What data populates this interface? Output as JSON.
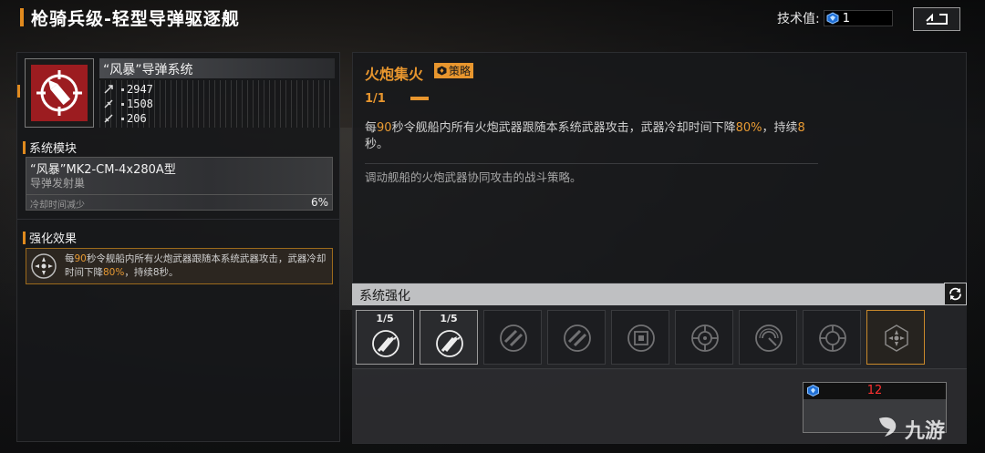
{
  "header": {
    "title": "枪骑兵级-轻型导弹驱逐舰",
    "tech_label": "技术值:",
    "tech_value": "1"
  },
  "weapon": {
    "name": "“风暴”导弹系统",
    "stats": [
      "2947",
      "1508",
      "206"
    ]
  },
  "module": {
    "section_title": "系统模块",
    "name": "“风暴”MK2-CM-4x280A型",
    "type": "导弹发射巢",
    "attr_label": "冷却时间减少",
    "attr_value": "6%"
  },
  "effect": {
    "section_title": "强化效果",
    "text_a": "每",
    "text_b": "90",
    "text_c": "秒令舰船内所有火炮武器跟随本系统武器攻击，武器冷却时间下降",
    "text_d": "80%",
    "text_e": "，持续8秒。"
  },
  "skill": {
    "name": "火炮集火",
    "tag": "策略",
    "level": "1/1",
    "desc_a": "每",
    "desc_b": "90",
    "desc_c": "秒令舰船内所有火炮武器跟随本系统武器攻击，武器冷却时间下降",
    "desc_d": "80%",
    "desc_e": "，持续",
    "desc_f": "8",
    "desc_g": "秒。",
    "flavor": "调动舰船的火炮武器协同攻击的战斗策略。"
  },
  "enhance": {
    "title": "系统强化",
    "slots": [
      {
        "level": "1/5",
        "icon": "missile-burst-icon",
        "state": "on"
      },
      {
        "level": "1/5",
        "icon": "missile-burst-icon",
        "state": "on"
      },
      {
        "level": "",
        "icon": "missile-pair-icon",
        "state": "off"
      },
      {
        "level": "",
        "icon": "missile-pair-icon",
        "state": "off"
      },
      {
        "level": "",
        "icon": "chip-icon",
        "state": "off"
      },
      {
        "level": "",
        "icon": "target-icon",
        "state": "off"
      },
      {
        "level": "",
        "icon": "radar-icon",
        "state": "off"
      },
      {
        "level": "",
        "icon": "target-icon",
        "state": "off"
      },
      {
        "level": "",
        "icon": "focus-fire-icon",
        "state": "sel"
      }
    ]
  },
  "cost": {
    "value": "12"
  },
  "watermark": "九游",
  "colors": {
    "accent": "#e8962e",
    "weapon_icon": "#9c1c20",
    "cost": "#ff3030"
  }
}
